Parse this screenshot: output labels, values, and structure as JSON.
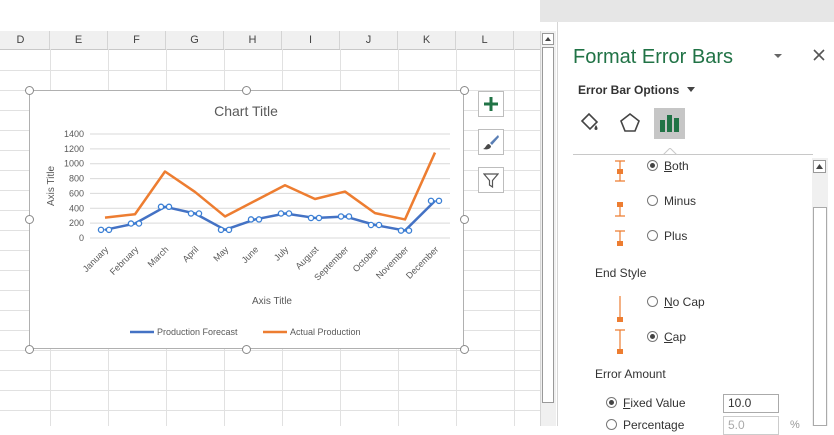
{
  "sheet": {
    "columns": [
      "D",
      "E",
      "F",
      "G",
      "H",
      "I",
      "J",
      "K",
      "L"
    ]
  },
  "chart_data": {
    "type": "line",
    "title": "Chart Title",
    "xlabel": "Axis Title",
    "ylabel": "Axis Title",
    "ylim": [
      0,
      1400
    ],
    "yticks": [
      0,
      200,
      400,
      600,
      800,
      1000,
      1200,
      1400
    ],
    "categories": [
      "January",
      "February",
      "March",
      "April",
      "May",
      "June",
      "July",
      "August",
      "September",
      "October",
      "November",
      "December"
    ],
    "series": [
      {
        "name": "Production Forecast",
        "color": "#4472c4",
        "values": [
          110,
          195,
          420,
          330,
          110,
          250,
          330,
          270,
          290,
          175,
          100,
          500
        ]
      },
      {
        "name": "Actual Production",
        "color": "#ed7d31",
        "values": [
          275,
          320,
          895,
          620,
          290,
          500,
          710,
          525,
          625,
          335,
          250,
          1150
        ]
      }
    ],
    "legend_position": "bottom",
    "grid": true
  },
  "chart_buttons": {
    "elements": "plus-icon",
    "styles": "brush-icon",
    "filters": "filter-icon"
  },
  "pane": {
    "title": "Format Error Bars",
    "section": "Error Bar Options",
    "direction_options": [
      "Both",
      "Minus",
      "Plus"
    ],
    "direction_selected": "Both",
    "end_style_label": "End Style",
    "end_style_options": [
      "No Cap",
      "Cap"
    ],
    "end_style_selected": "Cap",
    "error_amount_label": "Error Amount",
    "fixed_value_label": "Fixed Value",
    "fixed_value": "10.0",
    "percentage_label": "Percentage",
    "percentage_value": "5.0",
    "percent_unit": "%",
    "accent_color": "#217346"
  }
}
